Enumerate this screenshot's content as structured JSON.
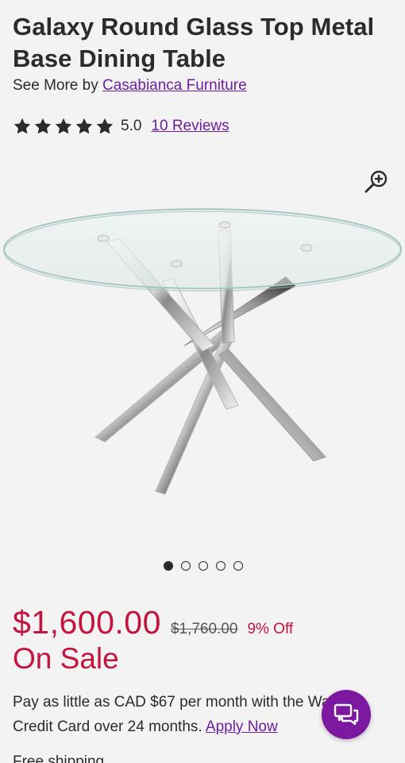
{
  "product": {
    "title": "Galaxy Round Glass Top Metal Base Dining Table",
    "see_more_prefix": "See More by",
    "brand": "Casabianca Furniture"
  },
  "rating": {
    "value": "5.0",
    "stars": 5,
    "reviews_label": "10 Reviews"
  },
  "gallery": {
    "dot_count": 5,
    "active_index": 0,
    "zoom_icon": "zoom-in-icon"
  },
  "pricing": {
    "price": "$1,600.00",
    "old_price": "$1,760.00",
    "discount": "9% Off",
    "sale_label": "On Sale"
  },
  "financing": {
    "text": "Pay as little as CAD $67 per month with the Wayfair Credit Card over 24 months.",
    "apply_label": "Apply Now"
  },
  "footer": {
    "partial_text": "Free shipping"
  },
  "colors": {
    "accent_purple": "#7b189f",
    "link_purple": "#6b1f9e",
    "sale_red": "#c4143d"
  }
}
